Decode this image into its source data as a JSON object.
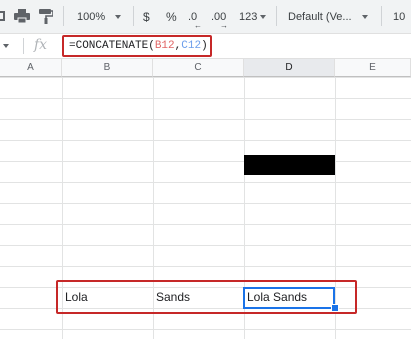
{
  "toolbar": {
    "zoom": "100%",
    "currency": "$",
    "percent": "%",
    "decrease_decimal": ".0",
    "increase_decimal": ".00",
    "more_formats": "123",
    "font": "Default (Ve...",
    "font_size": "10"
  },
  "formula_bar": {
    "fx": "fx",
    "prefix": "=CONCATENATE(",
    "ref1": "B12",
    "comma": ",",
    "ref2": "C12",
    "suffix": ")"
  },
  "columns": [
    "A",
    "B",
    "C",
    "D",
    "E"
  ],
  "selected_column": "D",
  "row12": {
    "B": "Lola",
    "C": "Sands",
    "D": "Lola Sands"
  },
  "colors": {
    "highlight": "#c62828",
    "selection": "#1a73e8",
    "ref1": "#e06666",
    "ref2": "#6d9eeb"
  }
}
